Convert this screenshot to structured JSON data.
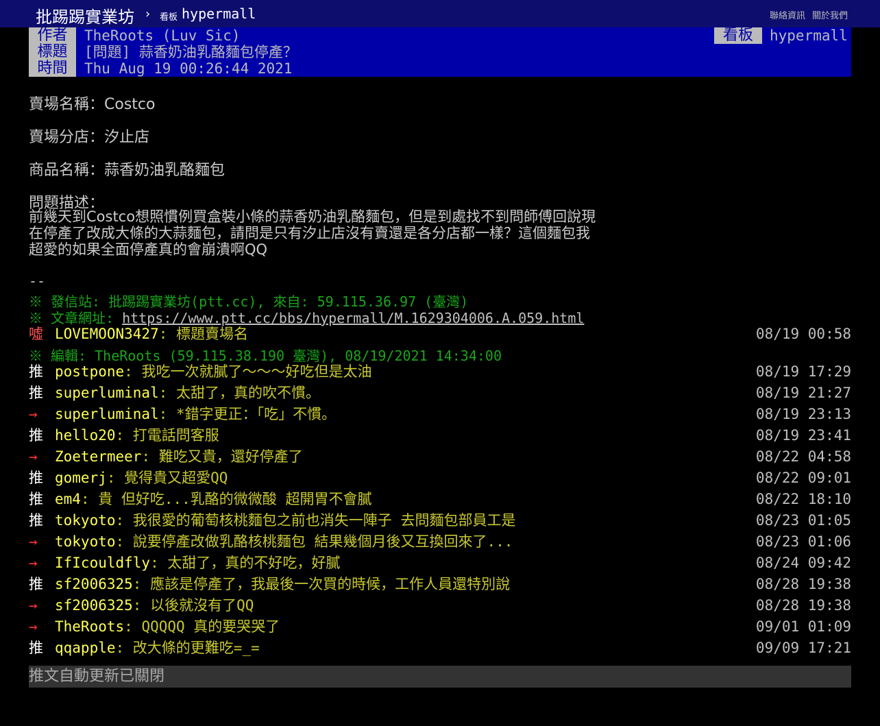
{
  "topbar": {
    "site_title": "批踢踢實業坊",
    "separator": "›",
    "board_label": "看板",
    "board_name": "hypermall",
    "contact": "聯絡資訊",
    "about": "關於我們"
  },
  "header": {
    "author_label": "作者",
    "author": "TheRoots (Luv Sic)",
    "title_label": "標題",
    "title": "[問題] 蒜香奶油乳酪麵包停產？",
    "time_label": "時間",
    "time": "Thu Aug 19 00:26:44 2021",
    "board_label": "看板",
    "board": "hypermall"
  },
  "body": {
    "store_name": "賣場名稱：Costco",
    "branch": "賣場分店：汐止店",
    "product": "商品名稱：蒜香奶油乳酪麵包",
    "question_label": "問題描述：",
    "desc_lines": [
      "前幾天到Costco想照慣例買盒裝小條的蒜香奶油乳酪麵包，但是到處找不到問師傅回說現",
      "在停產了改成大條的大蒜麵包，請問是只有汐止店沒有賣還是各分店都一樣？這個麵包我",
      "超愛的如果全面停產真的會崩潰啊QQ"
    ],
    "separator": "--"
  },
  "signature": {
    "origin": "※ 發信站: 批踢踢實業坊(ptt.cc), 來自: 59.115.36.97 (臺灣)",
    "url_prefix": "※ 文章網址: ",
    "url": "https://www.ptt.cc/bbs/hypermall/M.1629304006.A.059.html"
  },
  "edit_note": "※ 編輯: TheRoots (59.115.38.190 臺灣), 08/19/2021 14:34:00",
  "pushes": [
    {
      "tag": "噓",
      "type": "boo",
      "user": "LOVEMOON3427",
      "content": ": 標題賣場名",
      "time": "08/19 00:58"
    },
    {
      "tag": "推",
      "type": "push",
      "user": "postpone",
      "content": ": 我吃一次就膩了～～～好吃但是太油",
      "time": "08/19 17:29"
    },
    {
      "tag": "推",
      "type": "push",
      "user": "superluminal",
      "content": ": 太甜了，真的吹不慣。",
      "time": "08/19 21:27"
    },
    {
      "tag": "→",
      "type": "arrow",
      "user": "superluminal",
      "content": ": *錯字更正：「吃」不慣。",
      "time": "08/19 23:13"
    },
    {
      "tag": "推",
      "type": "push",
      "user": "hello20",
      "content": ": 打電話問客服",
      "time": "08/19 23:41"
    },
    {
      "tag": "→",
      "type": "arrow",
      "user": "Zoetermeer",
      "content": ": 難吃又貴，還好停產了",
      "time": "08/22 04:58"
    },
    {
      "tag": "推",
      "type": "push",
      "user": "gomerj",
      "content": ": 覺得貴又超愛QQ",
      "time": "08/22 09:01"
    },
    {
      "tag": "推",
      "type": "push",
      "user": "em4",
      "content": ": 貴 但好吃...乳酪的微微酸 超開胃不會膩",
      "time": "08/22 18:10"
    },
    {
      "tag": "推",
      "type": "push",
      "user": "tokyoto",
      "content": ": 我很愛的葡萄核桃麵包之前也消失一陣子 去問麵包部員工是",
      "time": "08/23 01:05"
    },
    {
      "tag": "→",
      "type": "arrow",
      "user": "tokyoto",
      "content": ": 說要停產改做乳酪核桃麵包 結果幾個月後又互換回來了...",
      "time": "08/23 01:06"
    },
    {
      "tag": "→",
      "type": "arrow",
      "user": "IfIcouldfly",
      "content": ": 太甜了，真的不好吃，好膩",
      "time": "08/24 09:42"
    },
    {
      "tag": "推",
      "type": "push",
      "user": "sf2006325",
      "content": ": 應該是停產了，我最後一次買的時候，工作人員還特別說",
      "time": "08/28 19:38"
    },
    {
      "tag": "→",
      "type": "arrow",
      "user": "sf2006325",
      "content": ": 以後就沒有了QQ",
      "time": "08/28 19:38"
    },
    {
      "tag": "→",
      "type": "arrow",
      "user": "TheRoots",
      "content": ": QQQQQ 真的要哭哭了",
      "time": "09/01 01:09"
    },
    {
      "tag": "推",
      "type": "push",
      "user": "qqapple",
      "content": ": 改大條的更難吃=_=",
      "time": "09/09 17:21"
    }
  ],
  "status_bar": "推文自動更新已關閉",
  "colors": {
    "topbar_bg": "#0d0d6e",
    "header_bg": "#0000a8",
    "push_user": "#ffff55",
    "push_content": "#c8c832",
    "signature_green": "#1aa51a",
    "arrow_red": "#ff3333"
  }
}
